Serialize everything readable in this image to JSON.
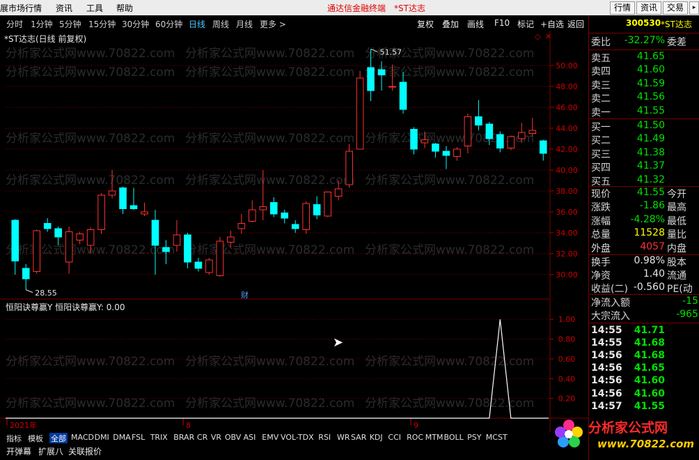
{
  "menu": {
    "items": [
      "展市场行情",
      "资讯",
      "工具",
      "帮助"
    ],
    "center_title": "通达信金融终端",
    "center_stock": "*ST达志",
    "right_buttons": [
      "行情",
      "资讯",
      "交易"
    ]
  },
  "periods": [
    "分时",
    "1分钟",
    "5分钟",
    "15分钟",
    "30分钟",
    "60分钟",
    "日线",
    "周线",
    "月线",
    "更多 >"
  ],
  "active_period": "日线",
  "tools": [
    "复权",
    "叠加",
    "画线",
    "F10",
    "标记",
    "+自选",
    "返回"
  ],
  "chart": {
    "title": "*ST达志(日线 前复权)",
    "watermark": "分析家公式网www.70822.com",
    "high_label": "51.57",
    "low_label": "28.55",
    "cai_label": "财",
    "y_ticks": [
      "50.00",
      "48.00",
      "46.00",
      "44.00",
      "42.00",
      "40.00",
      "38.00",
      "36.00",
      "34.00",
      "32.00",
      "30.00"
    ],
    "indicator_title": "恒阳诀尊赢Y  恒阳诀尊赢Y: 0.00",
    "ind_ticks": [
      "1.00",
      "0.80",
      "0.60",
      "0.40",
      "0.20"
    ],
    "x_labels": [
      "2021年",
      "8",
      "9"
    ]
  },
  "chart_data": {
    "type": "candlestick",
    "ylim": [
      28,
      52
    ],
    "candles": [
      {
        "o": 35.2,
        "c": 31.3,
        "h": 35.3,
        "l": 30.0
      },
      {
        "o": 30.6,
        "c": 29.6,
        "h": 31.0,
        "l": 28.55
      },
      {
        "o": 30.3,
        "c": 34.2,
        "h": 34.3,
        "l": 30.1
      },
      {
        "o": 34.9,
        "c": 34.4,
        "h": 35.4,
        "l": 34.1
      },
      {
        "o": 34.4,
        "c": 33.6,
        "h": 34.6,
        "l": 32.8
      },
      {
        "o": 31.2,
        "c": 34.1,
        "h": 34.6,
        "l": 30.1
      },
      {
        "o": 33.3,
        "c": 33.9,
        "h": 34.1,
        "l": 32.9
      },
      {
        "o": 32.8,
        "c": 34.3,
        "h": 34.5,
        "l": 32.0
      },
      {
        "o": 34.3,
        "c": 37.6,
        "h": 37.8,
        "l": 33.9
      },
      {
        "o": 37.6,
        "c": 38.0,
        "h": 40.0,
        "l": 37.3
      },
      {
        "o": 38.3,
        "c": 36.3,
        "h": 38.4,
        "l": 35.8
      },
      {
        "o": 36.6,
        "c": 36.3,
        "h": 38.3,
        "l": 36.2
      },
      {
        "o": 35.8,
        "c": 36.0,
        "h": 36.9,
        "l": 35.6
      },
      {
        "o": 35.2,
        "c": 32.8,
        "h": 36.2,
        "l": 30.0
      },
      {
        "o": 32.6,
        "c": 32.2,
        "h": 33.3,
        "l": 31.0
      },
      {
        "o": 32.8,
        "c": 33.8,
        "h": 35.2,
        "l": 32.2
      },
      {
        "o": 33.8,
        "c": 31.2,
        "h": 34.0,
        "l": 30.6
      },
      {
        "o": 31.2,
        "c": 30.6,
        "h": 31.6,
        "l": 30.3
      },
      {
        "o": 30.2,
        "c": 31.4,
        "h": 31.6,
        "l": 30.0
      },
      {
        "o": 29.9,
        "c": 33.2,
        "h": 33.6,
        "l": 29.8
      },
      {
        "o": 33.1,
        "c": 33.6,
        "h": 34.2,
        "l": 32.6
      },
      {
        "o": 34.4,
        "c": 34.9,
        "h": 35.8,
        "l": 33.9
      },
      {
        "o": 35.1,
        "c": 36.2,
        "h": 37.1,
        "l": 35.0
      },
      {
        "o": 36.2,
        "c": 36.5,
        "h": 40.0,
        "l": 35.2
      },
      {
        "o": 36.9,
        "c": 35.8,
        "h": 37.4,
        "l": 35.5
      },
      {
        "o": 35.9,
        "c": 35.4,
        "h": 36.2,
        "l": 34.9
      },
      {
        "o": 34.8,
        "c": 34.4,
        "h": 35.2,
        "l": 34.0
      },
      {
        "o": 34.3,
        "c": 36.8,
        "h": 37.0,
        "l": 33.9
      },
      {
        "o": 36.7,
        "c": 35.7,
        "h": 37.5,
        "l": 35.3
      },
      {
        "o": 35.6,
        "c": 37.9,
        "h": 37.9,
        "l": 35.5
      },
      {
        "o": 37.5,
        "c": 38.2,
        "h": 39.0,
        "l": 37.1
      },
      {
        "o": 38.6,
        "c": 41.8,
        "h": 42.5,
        "l": 38.3
      },
      {
        "o": 42.0,
        "c": 48.8,
        "h": 49.5,
        "l": 42.0
      },
      {
        "o": 49.8,
        "c": 47.6,
        "h": 51.57,
        "l": 46.6
      },
      {
        "o": 49.6,
        "c": 49.1,
        "h": 50.4,
        "l": 47.6
      },
      {
        "o": 48.0,
        "c": 48.0,
        "h": 50.1,
        "l": 47.6
      },
      {
        "o": 48.4,
        "c": 45.8,
        "h": 49.4,
        "l": 45.4
      },
      {
        "o": 43.9,
        "c": 42.0,
        "h": 44.1,
        "l": 41.5
      },
      {
        "o": 42.6,
        "c": 42.9,
        "h": 43.7,
        "l": 42.1
      },
      {
        "o": 42.5,
        "c": 41.8,
        "h": 42.6,
        "l": 41.2
      },
      {
        "o": 41.8,
        "c": 41.4,
        "h": 42.3,
        "l": 40.1
      },
      {
        "o": 41.3,
        "c": 42.0,
        "h": 42.2,
        "l": 40.9
      },
      {
        "o": 42.3,
        "c": 45.1,
        "h": 45.4,
        "l": 41.6
      },
      {
        "o": 45.1,
        "c": 44.3,
        "h": 46.7,
        "l": 43.8
      },
      {
        "o": 44.4,
        "c": 43.0,
        "h": 44.6,
        "l": 42.4
      },
      {
        "o": 43.4,
        "c": 42.1,
        "h": 43.7,
        "l": 41.7
      },
      {
        "o": 42.1,
        "c": 43.2,
        "h": 43.3,
        "l": 41.9
      },
      {
        "o": 43.0,
        "c": 43.6,
        "h": 44.5,
        "l": 42.6
      },
      {
        "o": 43.5,
        "c": 43.8,
        "h": 45.0,
        "l": 43.2
      },
      {
        "o": 42.8,
        "c": 41.6,
        "h": 42.9,
        "l": 40.9
      }
    ],
    "indicator": {
      "ylim": [
        0,
        1.1
      ],
      "spike_index": 45,
      "spike_value": 1.0
    }
  },
  "right_panel": {
    "code": "300530",
    "name": "*ST达志",
    "weibi_label": "委比",
    "weibi": "-32.27%",
    "weicha_label": "委差",
    "asks": [
      {
        "label": "卖五",
        "price": "41.65"
      },
      {
        "label": "卖四",
        "price": "41.60"
      },
      {
        "label": "卖三",
        "price": "41.59"
      },
      {
        "label": "卖二",
        "price": "41.56"
      },
      {
        "label": "卖一",
        "price": "41.55"
      }
    ],
    "bids": [
      {
        "label": "买一",
        "price": "41.50"
      },
      {
        "label": "买二",
        "price": "41.49"
      },
      {
        "label": "买三",
        "price": "41.38"
      },
      {
        "label": "买四",
        "price": "41.37"
      },
      {
        "label": "买五",
        "price": "41.32"
      }
    ],
    "stats": [
      {
        "label": "现价",
        "value": "41.55",
        "extra": "今开",
        "color": "#00e000"
      },
      {
        "label": "涨跌",
        "value": "-1.86",
        "extra": "最高",
        "color": "#00e000"
      },
      {
        "label": "涨幅",
        "value": "-4.28%",
        "extra": "最低",
        "color": "#00e000"
      },
      {
        "label": "总量",
        "value": "11528",
        "extra": "量比",
        "color": "#ffff00"
      },
      {
        "label": "外盘",
        "value": "4057",
        "extra": "内盘",
        "color": "#ff3030"
      }
    ],
    "stats2": [
      {
        "label": "换手",
        "value": "0.98%",
        "extra": "股本",
        "color": "#e6e6e6"
      },
      {
        "label": "净资",
        "value": "1.40",
        "extra": "流通",
        "color": "#e6e6e6"
      },
      {
        "label": "收益(二)",
        "value": "-0.560",
        "extra": "PE(动",
        "color": "#e6e6e6"
      }
    ],
    "flows": [
      {
        "label": "净流入额",
        "value": "-15"
      },
      {
        "label": "大宗流入",
        "value": "-965"
      }
    ],
    "ticks": [
      {
        "time": "14:55",
        "price": "41.71"
      },
      {
        "time": "14:55",
        "price": "41.68"
      },
      {
        "time": "14:56",
        "price": "41.68"
      },
      {
        "time": "14:56",
        "price": "41.65"
      },
      {
        "time": "14:56",
        "price": "41.60"
      },
      {
        "time": "14:56",
        "price": "41.60"
      },
      {
        "time": "14:57",
        "price": "41.55"
      }
    ]
  },
  "index_tabs": [
    "指标",
    "模板",
    "全部",
    "MACD",
    "DMI",
    "DMA",
    "FSL",
    "TRIX",
    "BRAR",
    "CR",
    "VR",
    "OBV",
    "ASI",
    "EMV",
    "VOL-TDX",
    "RSI",
    "WR",
    "SAR",
    "KDJ",
    "CCI",
    "ROC",
    "MTM",
    "BOLL",
    "PSY",
    "MCST"
  ],
  "active_index_tab": "全部",
  "bottom_tabs": [
    "开弹幕",
    "扩展八",
    "关联报价"
  ],
  "logo": {
    "text": "分析家公式网",
    "url": "www.70822.com"
  },
  "colors": {
    "up": "#ff3232",
    "down": "#00ffff",
    "grid": "#7a0000",
    "axis": "#b00000"
  }
}
